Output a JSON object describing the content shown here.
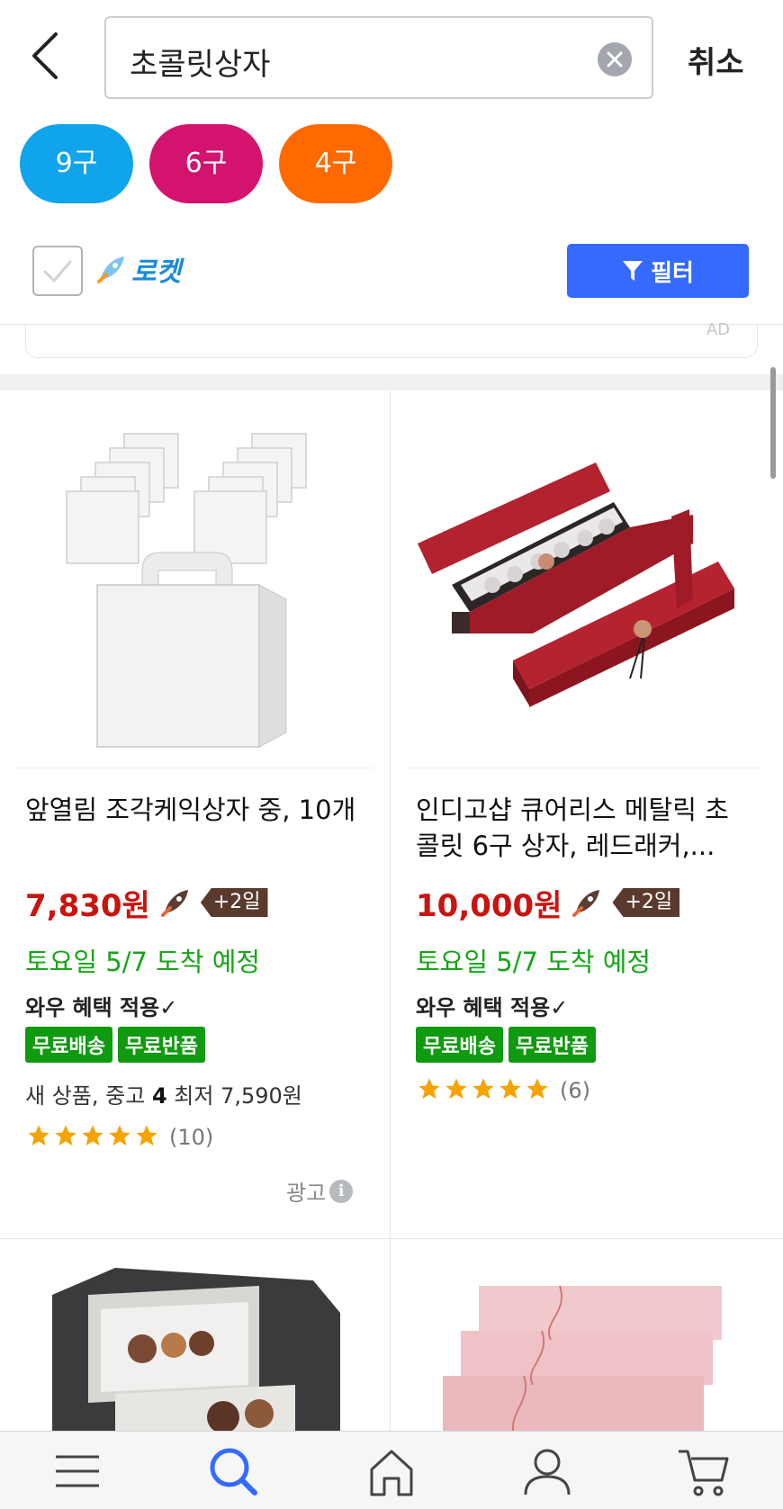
{
  "search": {
    "query": "초콜릿상자",
    "cancel_label": "취소"
  },
  "chips": [
    {
      "label": "9구",
      "color": "#10a4ec"
    },
    {
      "label": "6구",
      "color": "#d3136e"
    },
    {
      "label": "4구",
      "color": "#ff6a00"
    }
  ],
  "filters": {
    "rocket_label": "로켓",
    "filter_label": "필터"
  },
  "products": [
    {
      "title": "앞열림 조각케익상자 중, 10개",
      "price": "7,830원",
      "days_badge": "+2일",
      "arrival": "토요일 5/7 도착 예정",
      "wow": "와우 혜택 적용✓",
      "badges": [
        "무료배송",
        "무료반품"
      ],
      "used_prefix": "새 상품, 중고",
      "used_count": "4",
      "used_suffix": "최저 7,590원",
      "stars": 5,
      "review_count": "(10)",
      "ad_label": "광고"
    },
    {
      "title": "인디고샵 큐어리스 메탈릭 초콜릿 6구 상자, 레드래커,...",
      "price": "10,000원",
      "days_badge": "+2일",
      "arrival": "토요일 5/7 도착 예정",
      "wow": "와우 혜택 적용✓",
      "badges": [
        "무료배송",
        "무료반품"
      ],
      "stars": 5,
      "review_count": "(6)"
    }
  ],
  "ad_mini_label": "AD",
  "info_icon_glyph": "i",
  "colors": {
    "accent_blue": "#346aff",
    "price_red": "#c8150f",
    "arrival_green": "#16a616",
    "star": "#f5a300"
  },
  "nav_icons": [
    "menu-icon",
    "search-icon",
    "home-icon",
    "user-icon",
    "cart-icon"
  ]
}
